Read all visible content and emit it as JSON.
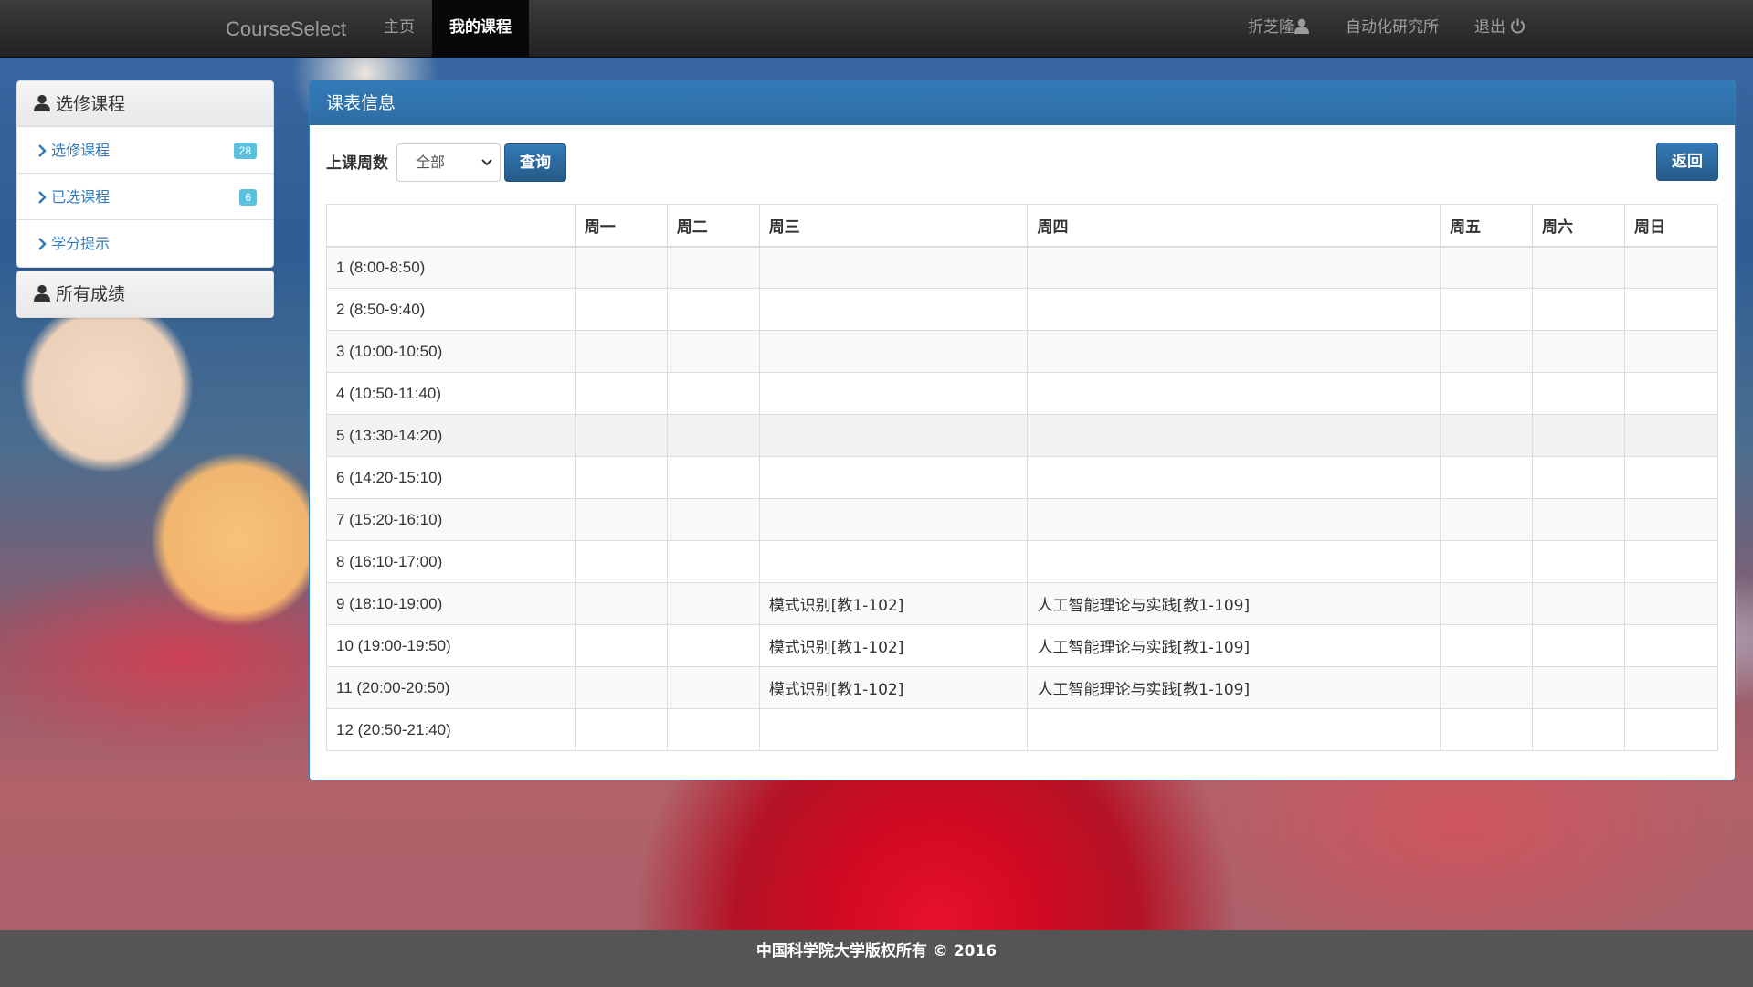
{
  "navbar": {
    "brand": "CourseSelect",
    "home": "主页",
    "my_courses": "我的课程",
    "user_name": "折芝隆",
    "org": "自动化研究所",
    "logout": "退出"
  },
  "sidebar": {
    "elective_header": "选修课程",
    "items": [
      {
        "label": "选修课程",
        "badge": "28"
      },
      {
        "label": "已选课程",
        "badge": "6"
      },
      {
        "label": "学分提示",
        "badge": ""
      }
    ],
    "grades_header": "所有成绩"
  },
  "main": {
    "title": "课表信息",
    "week_label": "上课周数",
    "week_selected": "全部",
    "query_button": "查询",
    "back_button": "返回"
  },
  "schedule": {
    "headers": [
      "",
      "周一",
      "周二",
      "周三",
      "周四",
      "周五",
      "周六",
      "周日"
    ],
    "rows": [
      {
        "time": "1 (8:00-8:50)",
        "cells": [
          "",
          "",
          "",
          "",
          "",
          "",
          ""
        ]
      },
      {
        "time": "2 (8:50-9:40)",
        "cells": [
          "",
          "",
          "",
          "",
          "",
          "",
          ""
        ]
      },
      {
        "time": "3 (10:00-10:50)",
        "cells": [
          "",
          "",
          "",
          "",
          "",
          "",
          ""
        ]
      },
      {
        "time": "4 (10:50-11:40)",
        "cells": [
          "",
          "",
          "",
          "",
          "",
          "",
          ""
        ]
      },
      {
        "time": "5 (13:30-14:20)",
        "cells": [
          "",
          "",
          "",
          "",
          "",
          "",
          ""
        ]
      },
      {
        "time": "6 (14:20-15:10)",
        "cells": [
          "",
          "",
          "",
          "",
          "",
          "",
          ""
        ]
      },
      {
        "time": "7 (15:20-16:10)",
        "cells": [
          "",
          "",
          "",
          "",
          "",
          "",
          ""
        ]
      },
      {
        "time": "8 (16:10-17:00)",
        "cells": [
          "",
          "",
          "",
          "",
          "",
          "",
          ""
        ]
      },
      {
        "time": "9 (18:10-19:00)",
        "cells": [
          "",
          "",
          "模式识别[教1-102]",
          "人工智能理论与实践[教1-109]",
          "",
          "",
          ""
        ]
      },
      {
        "time": "10 (19:00-19:50)",
        "cells": [
          "",
          "",
          "模式识别[教1-102]",
          "人工智能理论与实践[教1-109]",
          "",
          "",
          ""
        ]
      },
      {
        "time": "11 (20:00-20:50)",
        "cells": [
          "",
          "",
          "模式识别[教1-102]",
          "人工智能理论与实践[教1-109]",
          "",
          "",
          ""
        ]
      },
      {
        "time": "12 (20:50-21:40)",
        "cells": [
          "",
          "",
          "",
          "",
          "",
          "",
          ""
        ]
      }
    ]
  },
  "footer": {
    "text": "中国科学院大学版权所有 © 2016"
  }
}
